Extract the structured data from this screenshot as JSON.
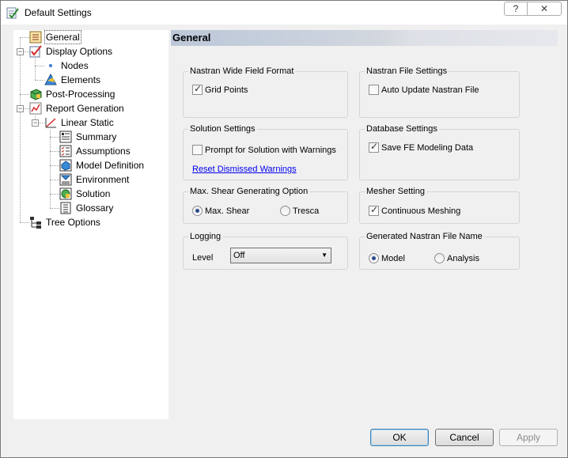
{
  "window": {
    "title": "Default Settings",
    "help_label": "?",
    "close_label": "✕"
  },
  "tree": {
    "items": [
      {
        "label": "General",
        "icon": "general-settings-icon"
      },
      {
        "label": "Display Options",
        "icon": "display-options-icon"
      },
      {
        "label": "Nodes",
        "icon": "node-dot-icon"
      },
      {
        "label": "Elements",
        "icon": "elements-icon"
      },
      {
        "label": "Post-Processing",
        "icon": "post-processing-icon"
      },
      {
        "label": "Report Generation",
        "icon": "report-icon"
      },
      {
        "label": "Linear Static",
        "icon": "linear-static-icon"
      },
      {
        "label": "Summary",
        "icon": "summary-icon"
      },
      {
        "label": "Assumptions",
        "icon": "assumptions-icon"
      },
      {
        "label": "Model Definition",
        "icon": "model-definition-icon"
      },
      {
        "label": "Environment",
        "icon": "environment-icon"
      },
      {
        "label": "Solution",
        "icon": "solution-icon"
      },
      {
        "label": "Glossary",
        "icon": "glossary-icon"
      },
      {
        "label": "Tree Options",
        "icon": "tree-options-icon"
      }
    ]
  },
  "panel": {
    "title": "General",
    "nastran_wide": {
      "title": "Nastran Wide Field Format",
      "grid_points_label": "Grid Points",
      "grid_points_checked": true
    },
    "nastran_file": {
      "title": "Nastran File Settings",
      "auto_update_label": "Auto Update Nastran File",
      "auto_update_checked": false
    },
    "solution": {
      "title": "Solution Settings",
      "prompt_label": "Prompt for Solution with Warnings",
      "prompt_checked": false,
      "reset_link": "Reset Dismissed Warnings"
    },
    "database": {
      "title": "Database Settings",
      "save_fe_label": "Save FE Modeling Data",
      "save_fe_checked": true
    },
    "max_shear": {
      "title": "Max. Shear Generating Option",
      "option1": "Max. Shear",
      "option2": "Tresca",
      "selected": "Max. Shear"
    },
    "mesher": {
      "title": "Mesher Setting",
      "continuous_label": "Continuous Meshing",
      "continuous_checked": true
    },
    "logging": {
      "title": "Logging",
      "level_label": "Level",
      "level_value": "Off"
    },
    "nastran_name": {
      "title": "Generated Nastran File Name",
      "option1": "Model",
      "option2": "Analysis",
      "selected": "Model"
    }
  },
  "buttons": {
    "ok": "OK",
    "cancel": "Cancel",
    "apply": "Apply"
  },
  "colors": {
    "link": "#0000ee",
    "header_gradient_start": "#bcc7d8",
    "radio_dot": "#2a4c8a"
  }
}
